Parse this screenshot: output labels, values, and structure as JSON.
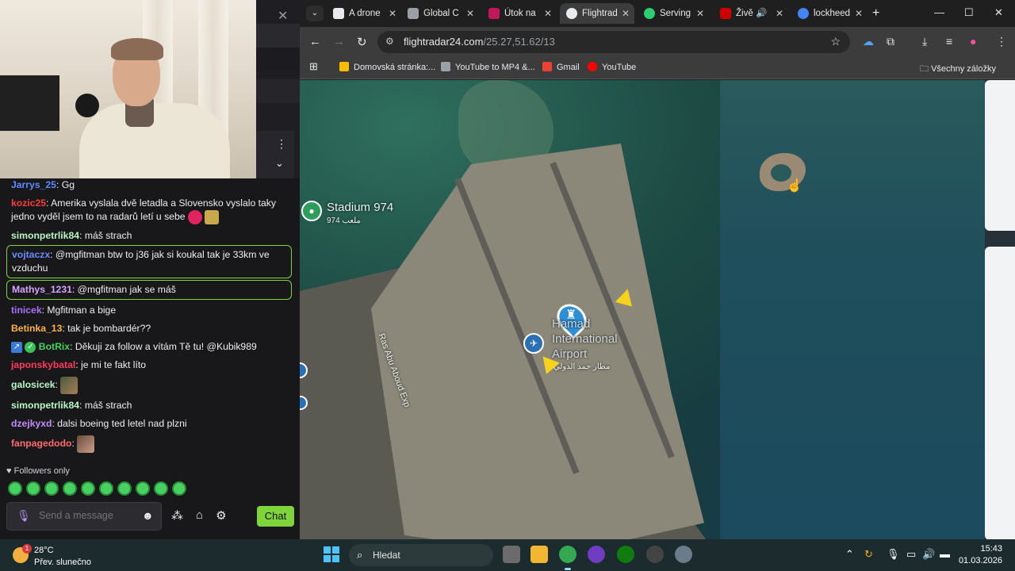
{
  "chat": {
    "messages": [
      {
        "user": "Jarrys_25",
        "color": "#5b8bff",
        "text": "Gg"
      },
      {
        "user": "kozic25",
        "color": "#ff3b3b",
        "text": "Amerika vyslala dvě letadla a Slovensko vyslalo taky jedno vyděl jsem to na radarů letí u sebe"
      },
      {
        "user": "simonpetrlik84",
        "color": "#b7f7c6",
        "text": "máš strach"
      },
      {
        "user": "vojtaczx",
        "color": "#6b8bff",
        "text": "@mgfitman btw to j36 jak si koukal tak je 33km ve vzduchu"
      },
      {
        "user": "Mathys_1231",
        "color": "#d6a3ff",
        "text": "@mgfitman jak se máš"
      },
      {
        "user": "tinicek",
        "color": "#a970ff",
        "text": "Mgfitman a bige"
      },
      {
        "user": "Betinka_13",
        "color": "#ffb347",
        "text": "tak je bombardér??"
      },
      {
        "user": "BotRix",
        "color": "#46d160",
        "text": "Děkuji za follow a vítám Tě tu! @Kubik989"
      },
      {
        "user": "japonskybatal",
        "color": "#ff3b5c",
        "text": "je mi te fakt líto"
      },
      {
        "user": "galosicek",
        "color": "#b7f7c6",
        "text": ""
      },
      {
        "user": "simonpetrlik84",
        "color": "#b7f7c6",
        "text": "máš strach"
      },
      {
        "user": "dzejkyxd",
        "color": "#c38bff",
        "text": "dalsi boeing ted letel nad plzni"
      },
      {
        "user": "fanpagedodo",
        "color": "#ff6b6b",
        "text": ""
      }
    ],
    "followers_only": "Followers only",
    "input_placeholder": "Send a message",
    "chat_button": "Chat"
  },
  "browser": {
    "tabs": [
      {
        "label": "A drone",
        "icon_color": "#e8eaed"
      },
      {
        "label": "Global C",
        "icon_color": "#9aa0a6"
      },
      {
        "label": "Útok na",
        "icon_color": "#c2185b"
      },
      {
        "label": "Flightrad",
        "icon_color": "#e8eaed"
      },
      {
        "label": "Serving",
        "icon_color": "#2ecc71"
      },
      {
        "label": "Živě",
        "icon_color": "#cc0000"
      },
      {
        "label": "lockheed",
        "icon_color": "#4285f4"
      }
    ],
    "active_tab_index": 3,
    "url_host": "flightradar24.com",
    "url_path": "/25.27,51.62/13",
    "bookmarks": [
      {
        "label": "Domovská stránka:...",
        "icon_color": "#fbbc05"
      },
      {
        "label": "YouTube to MP4 &...",
        "icon_color": "#9aa0a6"
      },
      {
        "label": "Gmail",
        "icon_color": "#ea4335"
      },
      {
        "label": "YouTube",
        "icon_color": "#ff0000"
      }
    ],
    "all_bookmarks": "Všechny záložky"
  },
  "map": {
    "stadium_label": "Stadium 974",
    "stadium_sub": "974 ملعب",
    "airport_line1": "Hamad",
    "airport_line2": "International",
    "airport_line3": "Airport",
    "airport_arabic": "مطار حمد الدولي",
    "road_label": "Ras Abu Aboud Exp"
  },
  "taskbar": {
    "temperature": "28°C",
    "condition": "Přev. slunečno",
    "weather_badge": "1",
    "search": "Hledat",
    "time": "15:43",
    "date": "01.03.2026"
  }
}
